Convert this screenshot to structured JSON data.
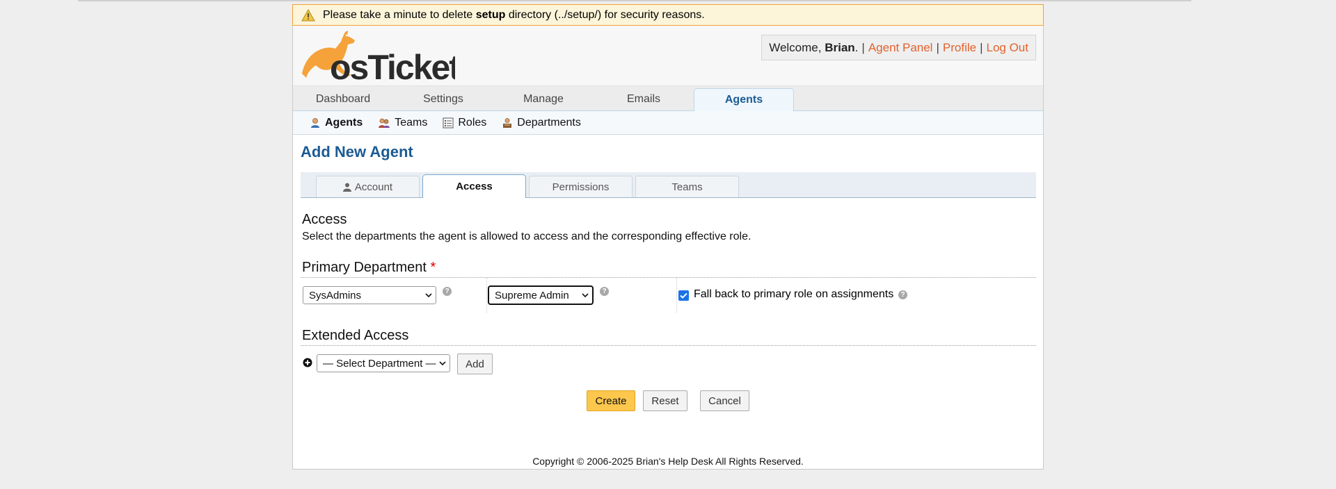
{
  "warning": {
    "prefix": "Please take a minute to delete ",
    "bold": "setup",
    "suffix": " directory (../setup/) for security reasons."
  },
  "logo": {
    "text": "osTicket"
  },
  "welcome": {
    "prefix": "Welcome, ",
    "user": "Brian",
    "dot": ".",
    "sep": "|",
    "links": [
      "Agent Panel",
      "Profile",
      "Log Out"
    ]
  },
  "nav": {
    "tabs": [
      "Dashboard",
      "Settings",
      "Manage",
      "Emails",
      "Agents"
    ],
    "active": "Agents"
  },
  "subnav": {
    "items": [
      "Agents",
      "Teams",
      "Roles",
      "Departments"
    ]
  },
  "page_title": "Add New Agent",
  "tabs": [
    "Account",
    "Access",
    "Permissions",
    "Teams"
  ],
  "access": {
    "title": "Access",
    "description": "Select the departments the agent is allowed to access and the corresponding effective role.",
    "primary_heading": "Primary Department",
    "required_mark": "*",
    "department_value": "SysAdmins",
    "role_value": "Supreme Admin",
    "fallback_label": "Fall back to primary role on assignments",
    "fallback_checked": true,
    "extended_heading": "Extended Access",
    "select_department_value": "— Select Department —",
    "add_label": "Add"
  },
  "buttons": {
    "create": "Create",
    "reset": "Reset",
    "cancel": "Cancel"
  },
  "footer": "Copyright © 2006-2025 Brian's Help Desk All Rights Reserved.",
  "colors": {
    "accent_blue": "#1b5b93",
    "link_orange": "#e2622d",
    "primary_button": "#fdc74d",
    "warning_bg": "#fdf5d9"
  }
}
